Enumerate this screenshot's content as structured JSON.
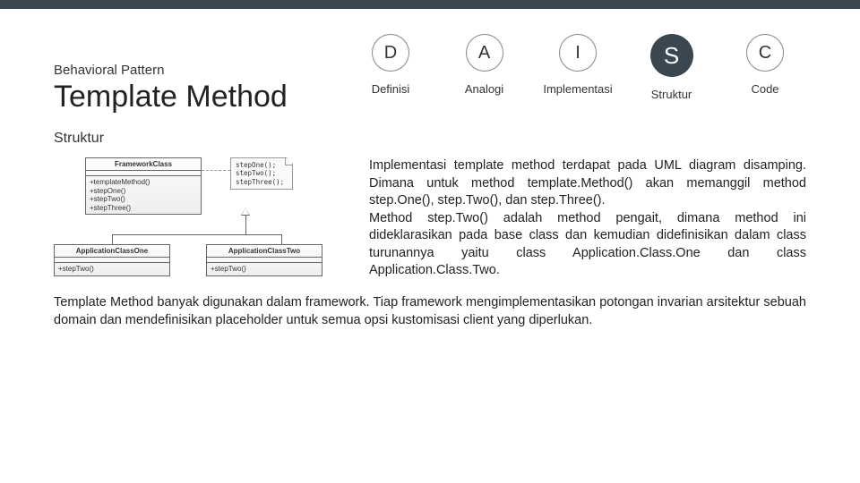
{
  "header": {
    "subtitle": "Behavioral Pattern",
    "title": "Template Method"
  },
  "nav": [
    {
      "letter": "D",
      "label": "Definisi",
      "active": false
    },
    {
      "letter": "A",
      "label": "Analogi",
      "active": false
    },
    {
      "letter": "I",
      "label": "Implementasi",
      "active": false
    },
    {
      "letter": "S",
      "label": "Struktur",
      "active": true
    },
    {
      "letter": "C",
      "label": "Code",
      "active": false
    }
  ],
  "section_label": "Struktur",
  "uml": {
    "framework": {
      "name": "FrameworkClass",
      "ops": "+templateMethod()\n+stepOne()\n+stepTwo()\n+stepThree()"
    },
    "note": "stepOne();\nstepTwo();\nstepThree();",
    "child1": {
      "name": "ApplicationClassOne",
      "ops": "+stepTwo()"
    },
    "child2": {
      "name": "ApplicationClassTwo",
      "ops": "+stepTwo()"
    }
  },
  "body": {
    "p1": "Implementasi template method terdapat pada UML diagram disamping. Dimana untuk method template.Method() akan memanggil method step.One(), step.Two(), dan step.Three().",
    "p2": "Method step.Two() adalah method pengait, dimana method ini dideklarasikan pada base class dan kemudian didefinisikan dalam class turunannya yaitu class Application.Class.One dan class Application.Class.Two."
  },
  "footer": "Template Method banyak digunakan dalam framework. Tiap framework mengimplementasikan potongan invarian arsitektur sebuah domain dan mendefinisikan placeholder untuk semua opsi kustomisasi client yang diperlukan."
}
